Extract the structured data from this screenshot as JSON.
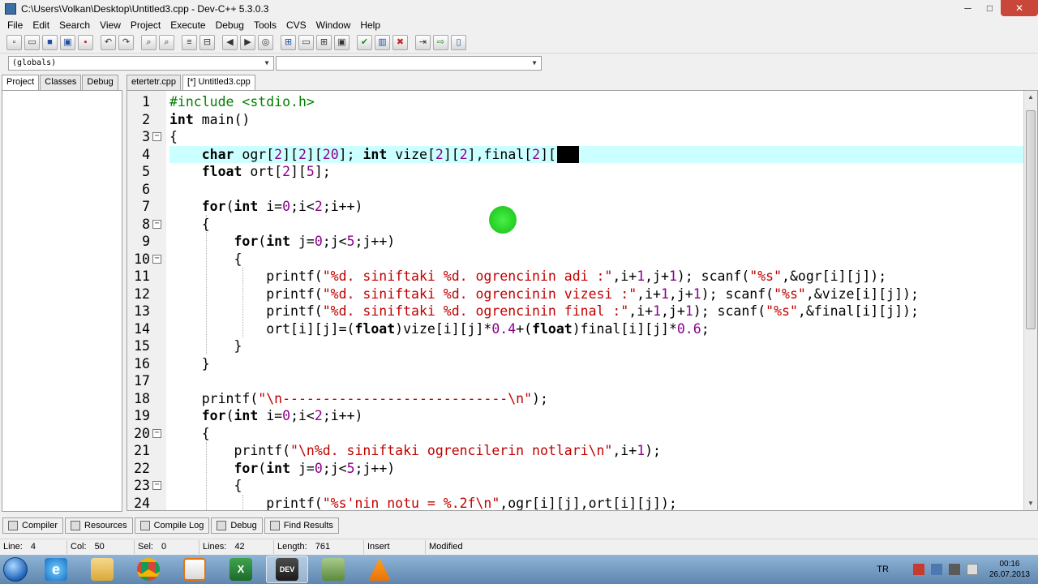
{
  "window": {
    "title": "C:\\Users\\Volkan\\Desktop\\Untitled3.cpp - Dev-C++ 5.3.0.3",
    "minimize": "─",
    "maximize": "□",
    "close": "✕"
  },
  "menu": [
    "File",
    "Edit",
    "Search",
    "View",
    "Project",
    "Execute",
    "Debug",
    "Tools",
    "CVS",
    "Window",
    "Help"
  ],
  "combos": {
    "scope": "(globals)",
    "member": ""
  },
  "left_tabs": [
    "Project",
    "Classes",
    "Debug"
  ],
  "editor_tabs": [
    "etertetr.cpp",
    "[*] Untitled3.cpp"
  ],
  "code": {
    "lines": [
      {
        "n": "1",
        "text": "#include <stdio.h>"
      },
      {
        "n": "2",
        "text": "int main()"
      },
      {
        "n": "3",
        "text": "{"
      },
      {
        "n": "4",
        "text": "    char ogr[2][2][20]; int vize[2][2],final[2][2];"
      },
      {
        "n": "5",
        "text": "    float ort[2][5];"
      },
      {
        "n": "6",
        "text": ""
      },
      {
        "n": "7",
        "text": "    for(int i=0;i<2;i++)"
      },
      {
        "n": "8",
        "text": "    {"
      },
      {
        "n": "9",
        "text": "        for(int j=0;j<5;j++)"
      },
      {
        "n": "10",
        "text": "        {"
      },
      {
        "n": "11",
        "text": "            printf(\"%d. siniftaki %d. ogrencinin adi :\",i+1,j+1); scanf(\"%s\",&ogr[i][j]);"
      },
      {
        "n": "12",
        "text": "            printf(\"%d. siniftaki %d. ogrencinin vizesi :\",i+1,j+1); scanf(\"%s\",&vize[i][j]);"
      },
      {
        "n": "13",
        "text": "            printf(\"%d. siniftaki %d. ogrencinin final :\",i+1,j+1); scanf(\"%s\",&final[i][j]);"
      },
      {
        "n": "14",
        "text": "            ort[i][j]=(float)vize[i][j]*0.4+(float)final[i][j]*0.6;"
      },
      {
        "n": "15",
        "text": "        }"
      },
      {
        "n": "16",
        "text": "    }"
      },
      {
        "n": "17",
        "text": ""
      },
      {
        "n": "18",
        "text": "    printf(\"\\n----------------------------\\n\");"
      },
      {
        "n": "19",
        "text": "    for(int i=0;i<2;i++)"
      },
      {
        "n": "20",
        "text": "    {"
      },
      {
        "n": "21",
        "text": "        printf(\"\\n%d. siniftaki ogrencilerin notlari\\n\",i+1);"
      },
      {
        "n": "22",
        "text": "        for(int j=0;j<5;j++)"
      },
      {
        "n": "23",
        "text": "        {"
      },
      {
        "n": "24",
        "text": "            printf(\"%s'nin notu = %.2f\\n\",ogr[i][j],ort[i][j]);"
      }
    ]
  },
  "bottom_tabs": [
    "Compiler",
    "Resources",
    "Compile Log",
    "Debug",
    "Find Results"
  ],
  "status": {
    "line_label": "Line:",
    "line_value": "4",
    "col_label": "Col:",
    "col_value": "50",
    "sel_label": "Sel:",
    "sel_value": "0",
    "lines_label": "Lines:",
    "lines_value": "42",
    "length_label": "Length:",
    "length_value": "761",
    "mode": "Insert",
    "state": "Modified"
  },
  "taskbar": {
    "apps": [
      "e",
      "",
      "",
      "",
      "X",
      "DEV",
      "",
      ""
    ],
    "lang": "TR",
    "time": "00:16",
    "date": "26.07.2013"
  },
  "colors": {
    "highlight_line": "#ccffff",
    "keyword": "#000000",
    "string": "#c00000",
    "number": "#8b008b",
    "preprocessor": "#008000"
  }
}
